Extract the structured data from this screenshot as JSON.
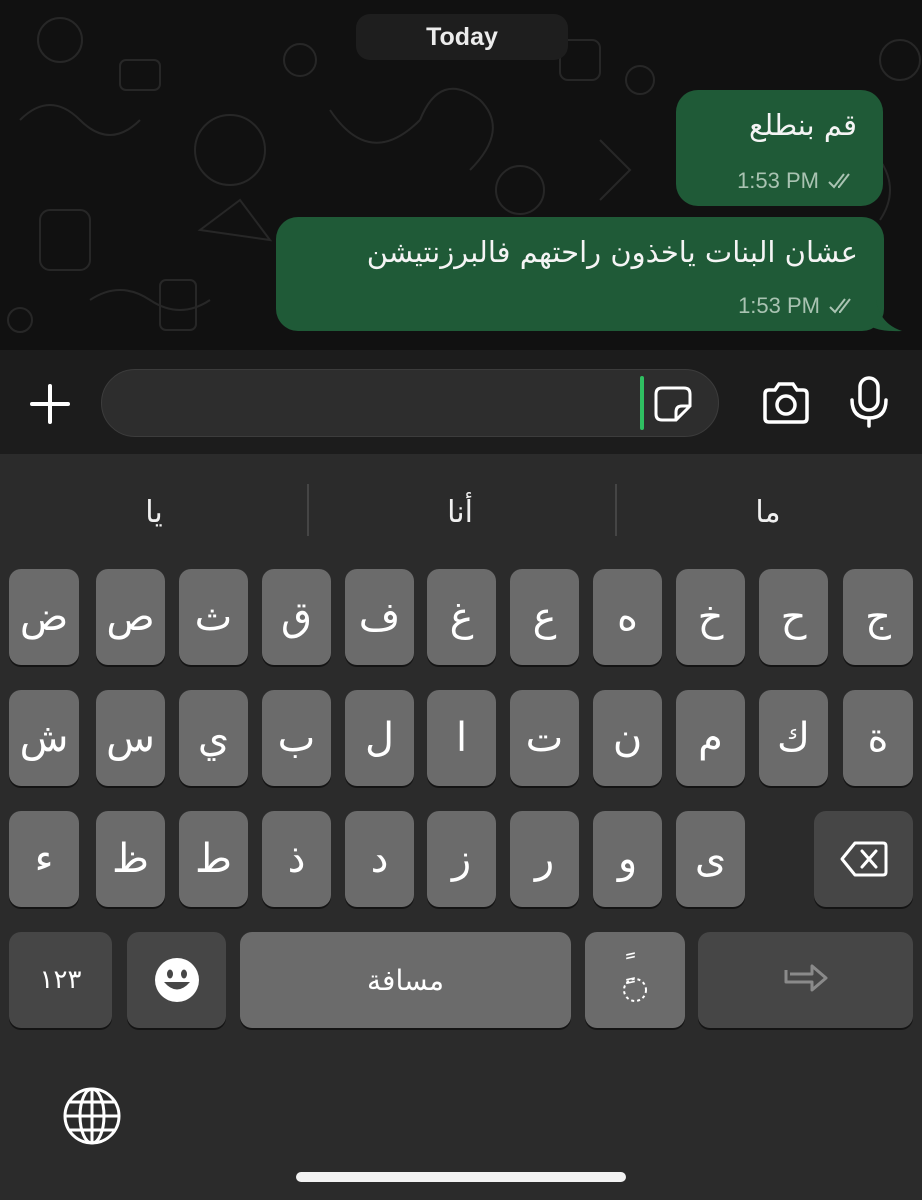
{
  "chat": {
    "date_separator": "Today",
    "messages": [
      {
        "text": "قم بنطلع",
        "time": "1:53 PM",
        "status": "read"
      },
      {
        "text": "عشان البنات ياخذون راحتهم فالبرزنتيشن",
        "time": "1:53 PM",
        "status": "read"
      }
    ]
  },
  "input_bar": {
    "message_value": "",
    "icons": [
      "plus-icon",
      "sticker-icon",
      "camera-icon",
      "microphone-icon"
    ],
    "accent_color": "#2fbf61"
  },
  "keyboard": {
    "suggestions": [
      "يا",
      "أنا",
      "ما"
    ],
    "rows": [
      [
        "ض",
        "ص",
        "ث",
        "ق",
        "ف",
        "غ",
        "ع",
        "ه",
        "خ",
        "ح",
        "ج"
      ],
      [
        "ش",
        "س",
        "ي",
        "ب",
        "ل",
        "ا",
        "ت",
        "ن",
        "م",
        "ك",
        "ة"
      ],
      [
        "ء",
        "ظ",
        "ط",
        "ذ",
        "د",
        "ز",
        "ر",
        "و",
        "ى"
      ]
    ],
    "numbers_key": "١٢٣",
    "space_key": "مسافة",
    "diacritic_key": "ًٍ",
    "icons": [
      "backspace-icon",
      "emoji-icon",
      "return-icon",
      "globe-icon"
    ]
  },
  "colors": {
    "bubble": "#1f5a37",
    "key": "#6b6b6b",
    "key_dark": "#464646",
    "keyboard_bg": "#2b2b2b"
  }
}
